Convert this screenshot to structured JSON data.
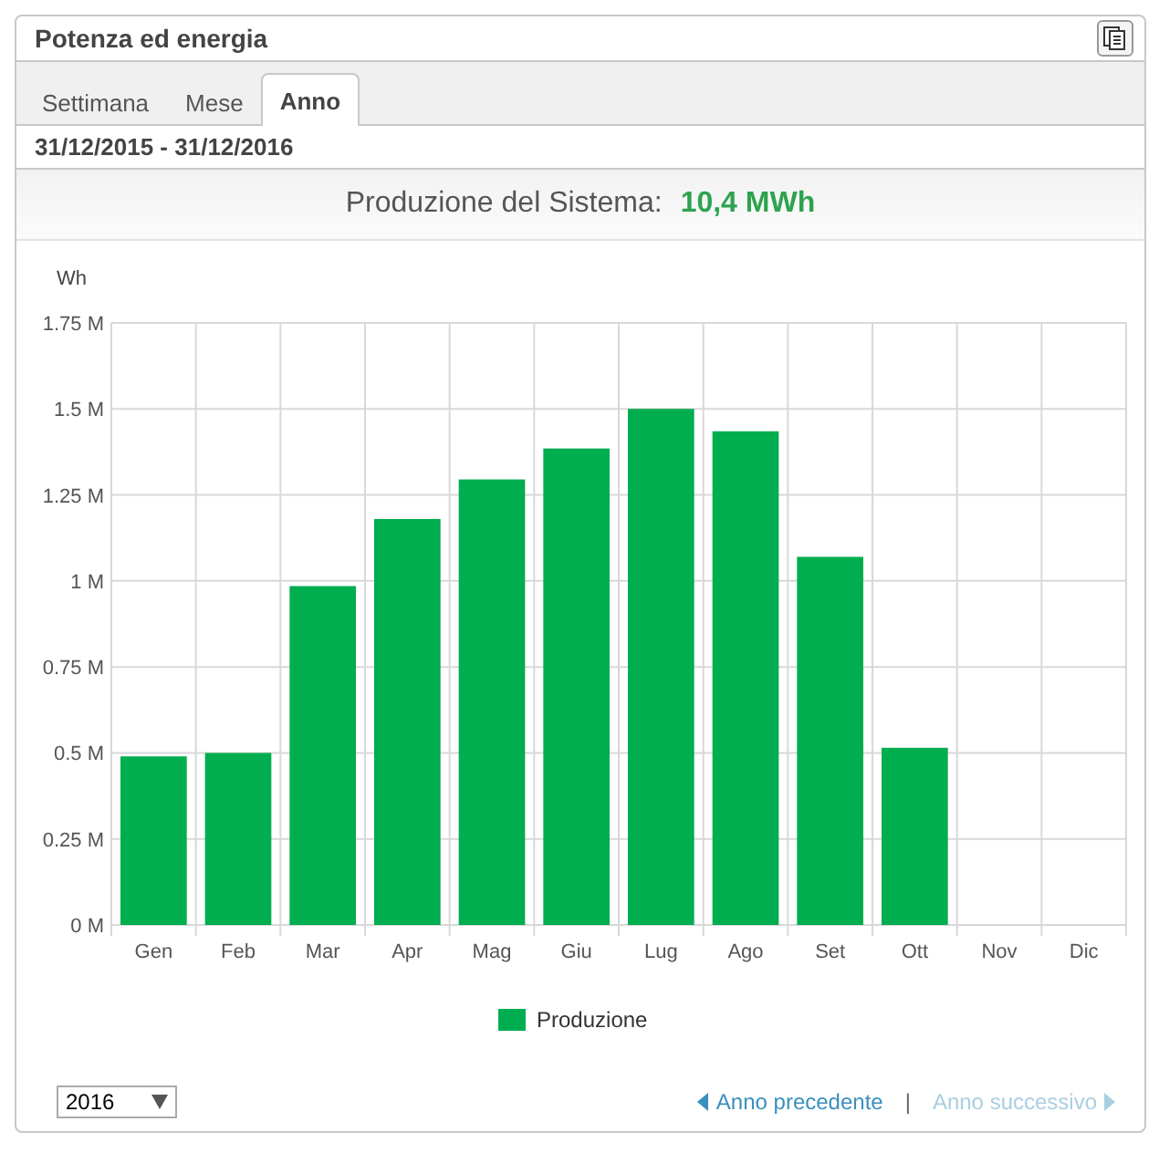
{
  "panel": {
    "title": "Potenza ed energia"
  },
  "tabs": [
    {
      "label": "Settimana",
      "selected": false
    },
    {
      "label": "Mese",
      "selected": false
    },
    {
      "label": "Anno",
      "selected": true
    }
  ],
  "date_range": "31/12/2015 - 31/12/2016",
  "summary": {
    "label": "Produzione del Sistema:",
    "value": "10,4 MWh"
  },
  "chart": {
    "chart_data": {
      "type": "bar",
      "ylabel": "Wh",
      "categories": [
        "Gen",
        "Feb",
        "Mar",
        "Apr",
        "Mag",
        "Giu",
        "Lug",
        "Ago",
        "Set",
        "Ott",
        "Nov",
        "Dic"
      ],
      "series": [
        {
          "name": "Produzione",
          "color": "#00ad4f",
          "values": [
            490000,
            500000,
            985000,
            1180000,
            1295000,
            1385000,
            1500000,
            1435000,
            1070000,
            515000,
            null,
            null
          ]
        }
      ],
      "ylim": [
        0,
        1750000
      ],
      "grid": true,
      "yticks": [
        {
          "value": 0,
          "label": "0 M"
        },
        {
          "value": 250000,
          "label": "0.25 M"
        },
        {
          "value": 500000,
          "label": "0.5 M"
        },
        {
          "value": 750000,
          "label": "0.75 M"
        },
        {
          "value": 1000000,
          "label": "1 M"
        },
        {
          "value": 1250000,
          "label": "1.25 M"
        },
        {
          "value": 1500000,
          "label": "1.5 M"
        },
        {
          "value": 1750000,
          "label": "1.75 M"
        }
      ]
    }
  },
  "year_select": {
    "value": "2016"
  },
  "navigation": [
    {
      "label": "Anno precedente",
      "kind": "prev",
      "disabled": false
    },
    {
      "label": "Anno successivo",
      "kind": "next",
      "disabled": true
    }
  ],
  "separator": "|"
}
